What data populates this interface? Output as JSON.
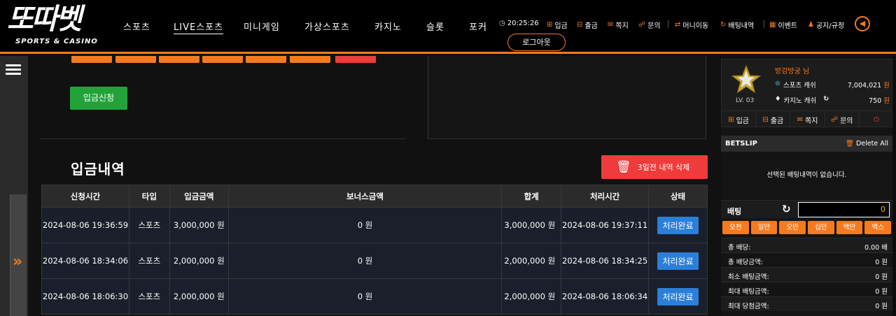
{
  "logo": {
    "main": "또따벳",
    "sub": "SPORTS & CASINO"
  },
  "nav": [
    "스포츠",
    "LIVE스포츠",
    "미니게임",
    "가상스포츠",
    "카지노",
    "슬롯",
    "포커"
  ],
  "util": {
    "time": "20:25:26",
    "deposit": "입금",
    "withdraw": "출금",
    "message": "쪽지",
    "inquiry": "문의",
    "money_move": "머니이동",
    "bet_history": "배팅내역",
    "event": "이벤트",
    "notice": "공지/규정"
  },
  "logout": "로그아웃",
  "deposit_apply": "입금신청",
  "history_title": "입금내역",
  "delete_3days": "3일전 내역 삭제",
  "table": {
    "headers": [
      "신청시간",
      "타입",
      "입금금액",
      "보너스금액",
      "합계",
      "처리시간",
      "상태"
    ],
    "rows": [
      [
        "2024-08-06 19:36:59",
        "스포츠",
        "3,000,000 원",
        "0 원",
        "3,000,000 원",
        "2024-08-06 19:37:11",
        "처리완료"
      ],
      [
        "2024-08-06 18:34:06",
        "스포츠",
        "2,000,000 원",
        "0 원",
        "2,000,000 원",
        "2024-08-06 18:34:25",
        "처리완료"
      ],
      [
        "2024-08-06 18:06:30",
        "스포츠",
        "2,000,000 원",
        "0 원",
        "2,000,000 원",
        "2024-08-06 18:06:34",
        "처리완료"
      ]
    ]
  },
  "profile": {
    "name": "방강방궁 님",
    "level": "LV. 03",
    "sports_label": "스포츠 캐쉬",
    "sports_value": "7,004,021",
    "casino_label": "카지노 캐쉬",
    "casino_value": "750",
    "won": "원"
  },
  "profile_actions": [
    "입금",
    "출금",
    "쪽지",
    "문의"
  ],
  "betslip": {
    "title": "BETSLIP",
    "delete_all": "Delete All",
    "empty": "선택된 배팅내역이 없습니다.",
    "bet_label": "배팅",
    "bet_value": "0"
  },
  "chips": [
    "오천",
    "일만",
    "오만",
    "십만",
    "백만",
    "맥스"
  ],
  "summary": [
    {
      "k": "총 배당:",
      "v": "0.00 배"
    },
    {
      "k": "총 배당금액:",
      "v": "0 원"
    },
    {
      "k": "최소 배팅금액:",
      "v": "0 원"
    },
    {
      "k": "최대 배팅금액:",
      "v": "0 원"
    },
    {
      "k": "최대 당첨금액:",
      "v": "0 원"
    }
  ],
  "colors": {
    "accent": "#f47b20",
    "danger": "#ef3b3b",
    "success": "#22a33a",
    "status": "#2b7fd9"
  }
}
